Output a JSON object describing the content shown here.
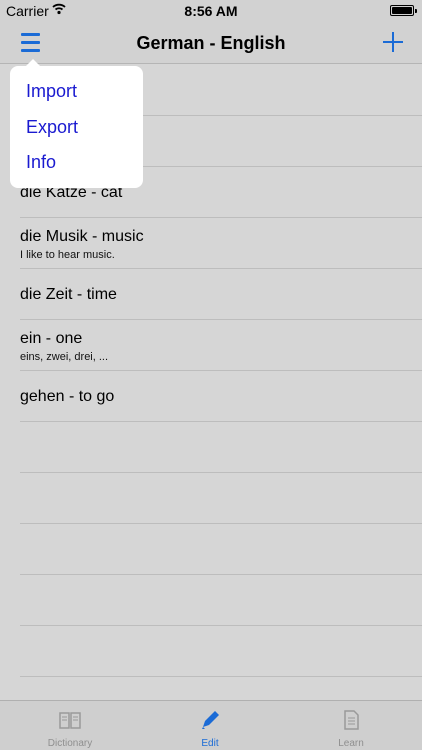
{
  "status_bar": {
    "carrier": "Carrier",
    "time": "8:56 AM",
    "battery_level": 1.0
  },
  "nav": {
    "title": "German - English",
    "left_icon": "menu-icon",
    "right_icon": "plus-icon"
  },
  "popover_menu": {
    "items": [
      "Import",
      "Export",
      "Info"
    ]
  },
  "list": {
    "rows": [
      {
        "title": "",
        "subtitle": ""
      },
      {
        "title": "",
        "subtitle": ""
      },
      {
        "title": "die Katze - cat",
        "subtitle": ""
      },
      {
        "title": "die Musik - music",
        "subtitle": "I like to hear music."
      },
      {
        "title": "die Zeit - time",
        "subtitle": ""
      },
      {
        "title": "ein - one",
        "subtitle": "eins, zwei, drei, ..."
      },
      {
        "title": "gehen - to go",
        "subtitle": ""
      }
    ]
  },
  "tab_bar": {
    "tabs": [
      {
        "label": "Dictionary",
        "icon": "book-icon",
        "active": false
      },
      {
        "label": "Edit",
        "icon": "pencil-icon",
        "active": true
      },
      {
        "label": "Learn",
        "icon": "document-icon",
        "active": false
      }
    ]
  },
  "colors": {
    "accent": "#1b6bd6",
    "menu_text": "#1a1ad0",
    "background": "#d6d6d6"
  }
}
